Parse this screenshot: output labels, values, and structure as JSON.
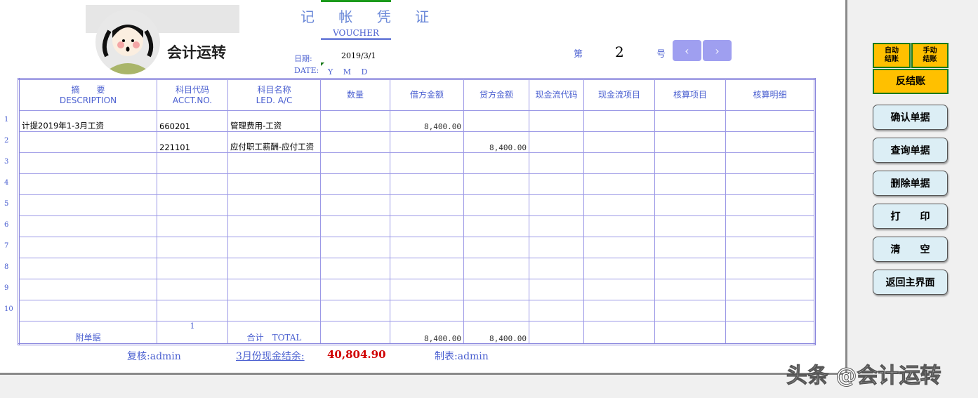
{
  "logo": {
    "text": "会计运转"
  },
  "header": {
    "title": "记 帐 凭 证",
    "subtitle": "VOUCHER",
    "date_label": "日期:",
    "date_value": "2019/3/1",
    "date_label_en": "DATE:",
    "ymd": "Y　 M　 D",
    "no_label": "第",
    "no_value": "2",
    "no_suffix": "号",
    "prev": "‹",
    "next": "›"
  },
  "columns": [
    {
      "cn": "摘　　要",
      "en": "DESCRIPTION"
    },
    {
      "cn": "科目代码",
      "en": "ACCT.NO."
    },
    {
      "cn": "科目名称",
      "en": "LED. A/C"
    },
    {
      "cn": "数量",
      "en": ""
    },
    {
      "cn": "借方金额",
      "en": ""
    },
    {
      "cn": "贷方金额",
      "en": ""
    },
    {
      "cn": "现金流代码",
      "en": ""
    },
    {
      "cn": "现金流项目",
      "en": ""
    },
    {
      "cn": "核算项目",
      "en": ""
    },
    {
      "cn": "核算明细",
      "en": ""
    }
  ],
  "rows": [
    {
      "n": "1",
      "desc": "计提2019年1-3月工资",
      "code": "660201",
      "name": "管理费用-工资",
      "qty": "",
      "debit": "8,400.00",
      "credit": ""
    },
    {
      "n": "2",
      "desc": "",
      "code": "221101",
      "name": "应付职工薪酬-应付工资",
      "qty": "",
      "debit": "",
      "credit": "8,400.00"
    },
    {
      "n": "3"
    },
    {
      "n": "4"
    },
    {
      "n": "5"
    },
    {
      "n": "6"
    },
    {
      "n": "7"
    },
    {
      "n": "8"
    },
    {
      "n": "9"
    },
    {
      "n": "10"
    }
  ],
  "totals": {
    "attach_label": "附单据",
    "attach_count": "1",
    "total_label": "合计　TOTAL",
    "debit": "8,400.00",
    "credit": "8,400.00"
  },
  "footer": {
    "reviewer": "复核:admin",
    "cash_label": "3月份现金结余:",
    "cash_value": "40,804.90",
    "maker": "制表:admin"
  },
  "buttons": {
    "auto_close": "自动\n结账",
    "manual_close": "手动\n结账",
    "reverse": "反结账",
    "confirm": "确认单据",
    "query": "查询单据",
    "delete": "删除单据",
    "print": "打　　印",
    "clear": "清　　空",
    "home": "返回主界面"
  },
  "watermark": "头条 @会计运转"
}
